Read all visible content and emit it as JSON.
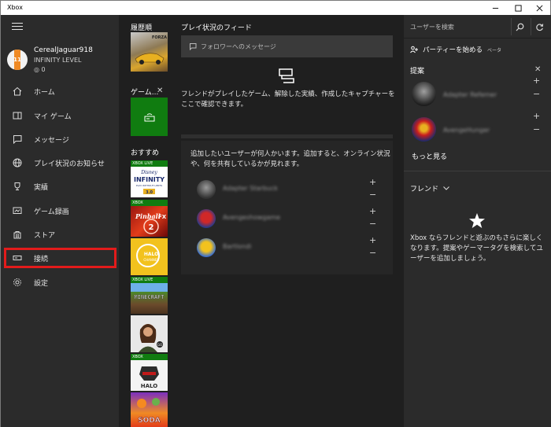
{
  "window": {
    "title": "Xbox"
  },
  "profile": {
    "gamertag": "CerealJaguar918",
    "level": "INFINITY LEVEL",
    "level_badge": "11",
    "gamerscore": "0"
  },
  "nav": {
    "items": [
      {
        "label": "ホーム",
        "icon": "home-icon"
      },
      {
        "label": "マイ ゲーム",
        "icon": "my-games-icon"
      },
      {
        "label": "メッセージ",
        "icon": "message-icon"
      },
      {
        "label": "プレイ状況のお知らせ",
        "icon": "globe-icon"
      },
      {
        "label": "実績",
        "icon": "trophy-icon"
      },
      {
        "label": "ゲーム録画",
        "icon": "game-dvr-icon"
      },
      {
        "label": "ストア",
        "icon": "store-icon"
      },
      {
        "label": "接続",
        "icon": "connect-icon"
      },
      {
        "label": "設定",
        "icon": "gear-icon"
      }
    ],
    "highlight_color": "#e21b1b"
  },
  "column2": {
    "recent_heading": "履歴順",
    "pinned_heading": "ゲーム...",
    "recommended_heading": "おすすめ",
    "tiles": [
      {
        "name": "forza-horizon",
        "tag": ""
      },
      {
        "name": "disney-infinity",
        "tag": "XBOX LIVE"
      },
      {
        "name": "pinball-fx2",
        "tag": "XBOX"
      },
      {
        "name": "halo-channel",
        "tag": ""
      },
      {
        "name": "minecraft",
        "tag": "XBOX LIVE"
      },
      {
        "name": "lara-croft",
        "tag": ""
      },
      {
        "name": "halo",
        "tag": "XBOX"
      },
      {
        "name": "candy-game",
        "tag": ""
      }
    ]
  },
  "feed": {
    "heading": "プレイ状況のフィード",
    "message_placeholder": "フォロワーへのメッセージ",
    "empty_text": "フレンドがプレイしたゲーム、解除した実績、作成したキャプチャーをここで確認できます。",
    "suggest_text": "追加したいユーザーが何人かいます。追加すると、オンライン状況や、何を共有しているかが見れます。",
    "suggestions": [
      {
        "name": "Adapter Starbuck"
      },
      {
        "name": "Avengeshowgame"
      },
      {
        "name": "Bartlondi"
      }
    ]
  },
  "right": {
    "search_placeholder": "ユーザーを検索",
    "party_label": "パーティーを始める",
    "party_beta": "ベータ",
    "suggestions_heading": "提案",
    "suggestions": [
      {
        "name": "Adapter Refemer"
      },
      {
        "name": "AvengeHunger"
      }
    ],
    "more_label": "もっと見る",
    "friends_heading": "フレンド",
    "friends_empty": "Xbox ならフレンドと遊ぶのもさらに楽しくなります。提案やゲーマータグを検索してユーザーを追加しましょう。"
  }
}
